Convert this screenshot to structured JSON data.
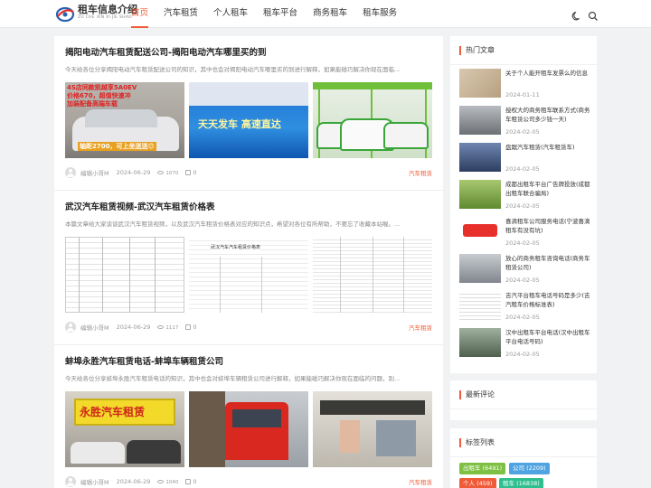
{
  "header": {
    "logo_title": "租车信息介绍",
    "logo_sub": "ZU CHE XIN XI JIE SHAO",
    "nav": [
      "首页",
      "汽车租赁",
      "个人租车",
      "租车平台",
      "商务租车",
      "租车服务"
    ],
    "active_nav": 0
  },
  "posts": [
    {
      "title": "揭阳电动汽车租赁配送公司-揭阳电动汽车哪里买的到",
      "excerpt": "今天给各位分享揭阳电动汽车租赁配送公司的知识，其中也会对揭阳电动汽车哪里买的到进行解释，如果能碰巧解决你现在面临...",
      "thumbs": [
        {
          "lines": [
            "4S店同款凯越享5A0EV",
            "价格670，超值快速冲",
            "加装配备高端车载",
            "轴距2700，可上坐送送😊"
          ]
        },
        {
          "lines": [
            "天天发车  高速直达"
          ]
        },
        {
          "lines": []
        }
      ],
      "author": "编辑小哥M",
      "date": "2024-06-29",
      "views": "1070",
      "comments": "0",
      "category": "汽车租赁"
    },
    {
      "title": "武汉汽车租赁视频-武汉汽车租赁价格表",
      "excerpt": "本篇文章给大家谈谈武汉汽车租赁视频，以及武汉汽车租赁价格表对应的知识点，希望对各位有所帮助，不要忘了收藏本站喔。...",
      "thumbs": [
        {
          "lines": []
        },
        {
          "lines": [
            "武汉汽车汽车租赁价格表"
          ]
        },
        {
          "lines": []
        }
      ],
      "author": "编辑小哥M",
      "date": "2024-06-29",
      "views": "1117",
      "comments": "0",
      "category": "汽车租赁"
    },
    {
      "title": "蚌埠永胜汽车租赁电话-蚌埠车辆租赁公司",
      "excerpt": "今天给各位分享蚌埠永胜汽车租赁电话的知识，其中也会对蚌埠车辆租赁公司进行解释，如果能碰巧解决你现在面临的问题，别...",
      "thumbs": [
        {
          "lines": [
            "永胜汽车租赁"
          ]
        },
        {
          "lines": []
        },
        {
          "lines": []
        }
      ],
      "author": "编辑小哥M",
      "date": "2024-06-29",
      "views": "1040",
      "comments": "0",
      "category": "汽车租赁"
    }
  ],
  "sidebar": {
    "hot_title": "热门文章",
    "hot": [
      {
        "title": "关于个人能开租车发票么的信息",
        "date": "2024-01-11",
        "color": "#c9b39a"
      },
      {
        "title": "授权大的商务租车联系方式(商务车租赁公司多少钱一天)",
        "date": "2024-02-05",
        "color": "#8a8f94"
      },
      {
        "title": "盘踞汽车租赁(汽车租赁车)",
        "date": "2024-02-05",
        "color": "#4a5a78"
      },
      {
        "title": "成都出租车平台广告牌投放(成都出租车联合骗局)",
        "date": "2024-02-05",
        "color": "#7fa24a"
      },
      {
        "title": "喜滴租车公司服务电话(宁波喜滴租车有没有坑)",
        "date": "2024-02-05",
        "color": "#d8342a"
      },
      {
        "title": "放心的商务租车咨询电话(商务车租赁公司)",
        "date": "2024-02-05",
        "color": "#9aa1a8"
      },
      {
        "title": "吉汽平台租车电话号码是多少(吉汽租车价格标准表)",
        "date": "2024-02-05",
        "color": "#e8e8e8"
      },
      {
        "title": "汉中出租车平台电话(汉中出租车平台电话号码)",
        "date": "2024-02-05",
        "color": "#6a7d6a"
      }
    ],
    "comments_title": "最新评论",
    "tags_title": "标签列表",
    "tags": [
      {
        "label": "出租车 (6491)",
        "color": "#7ec043"
      },
      {
        "label": "公司 (2209)",
        "color": "#4fa3e0"
      },
      {
        "label": "个人 (459)",
        "color": "#ef5a38"
      },
      {
        "label": "租车 (16838)",
        "color": "#2fbf8f"
      }
    ]
  }
}
